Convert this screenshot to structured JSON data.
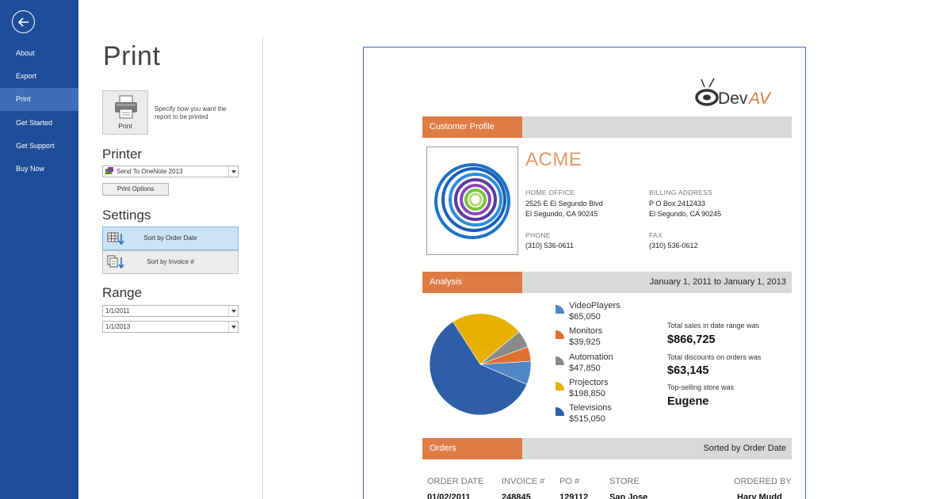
{
  "nav": {
    "items": [
      {
        "label": "About",
        "active": false
      },
      {
        "label": "Export",
        "active": false
      },
      {
        "label": "Print",
        "active": true
      },
      {
        "label": "Get Started",
        "active": false
      },
      {
        "label": "Get Support",
        "active": false
      },
      {
        "label": "Buy Now",
        "active": false
      }
    ]
  },
  "settings": {
    "title": "Print",
    "print_button_label": "Print",
    "print_description": "Specify how you want the report to be printed",
    "printer_heading": "Printer",
    "printer_value": "Send To OneNote 2013",
    "print_options_label": "Print Options",
    "settings_heading": "Settings",
    "sort_by_order_date": "Sort by Order Date",
    "sort_by_invoice": "Sort by Invoice #",
    "range_heading": "Range",
    "range_start": "1/1/2011",
    "range_end": "1/1/2013"
  },
  "report": {
    "logo_text": "DevAV",
    "customer_profile_title": "Customer Profile",
    "customer_name": "ACME",
    "home_office_label": "HOME OFFICE",
    "home_office_line1": "2525 E El Segundo Blvd",
    "home_office_line2": "El Segundo, CA 90245",
    "billing_address_label": "BILLING ADDRESS",
    "billing_line1": "P O Box 2412433",
    "billing_line2": "El Segundo, CA 90245",
    "phone_label": "PHONE",
    "phone_value": "(310) 536-0611",
    "fax_label": "FAX",
    "fax_value": "(310) 536-0612",
    "analysis_title": "Analysis",
    "analysis_date_range": "January 1, 2011 to January 1, 2013",
    "total_sales_label": "Total sales in date range was",
    "total_sales_value": "$866,725",
    "total_discounts_label": "Total discounts on orders was",
    "total_discounts_value": "$63,145",
    "top_store_label": "Top-selling store was",
    "top_store_value": "Eugene",
    "orders_title": "Orders",
    "orders_sort": "Sorted by Order Date",
    "orders_columns": [
      "ORDER DATE",
      "INVOICE #",
      "PO #",
      "STORE",
      "ORDERED BY"
    ],
    "orders_first_row": [
      "01/02/2011",
      "248845",
      "129112",
      "San Jose",
      "Hary Mudd"
    ]
  },
  "colors": {
    "rail": "#1e4e9a",
    "accent_orange": "#df7c45",
    "band_gray": "#d9d9d9"
  },
  "chart_data": {
    "type": "pie",
    "categories": [
      "VideoPlayers",
      "Monitors",
      "Automation",
      "Projectors",
      "Televisions"
    ],
    "values": [
      65050,
      39925,
      47850,
      198850,
      515050
    ],
    "value_labels": [
      "$65,050",
      "$39,925",
      "$47,850",
      "$198,850",
      "$515,050"
    ],
    "colors": [
      "#4f86c6",
      "#e0702f",
      "#8a8a8a",
      "#e8b000",
      "#2f5ea8"
    ]
  }
}
